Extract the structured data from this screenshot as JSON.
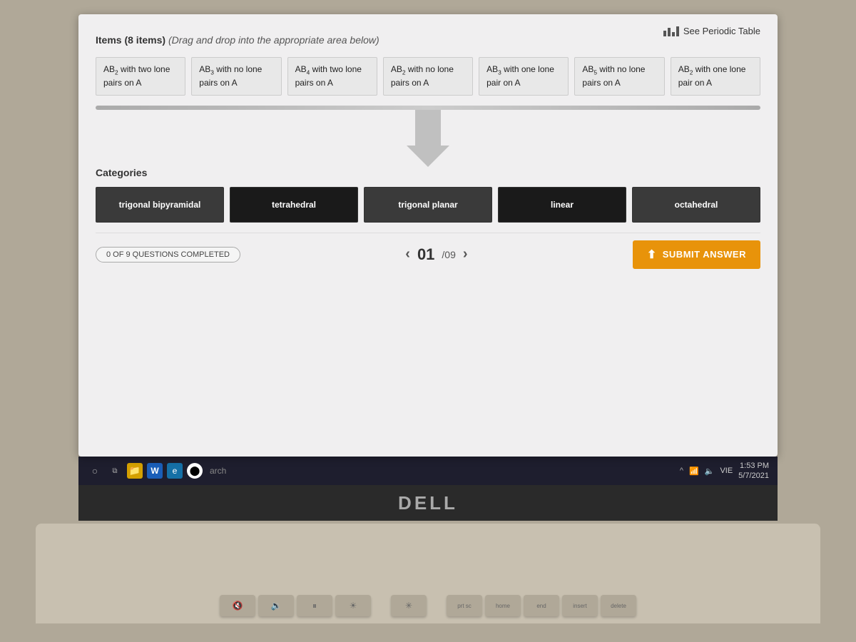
{
  "header": {
    "periodic_table_link": "See Periodic Table",
    "items_label": "Items (8 items)",
    "items_instruction": "(Drag and drop into the appropriate area below)"
  },
  "drag_items": [
    {
      "id": "item1",
      "label": "AB₂ with two lone pairs on A"
    },
    {
      "id": "item2",
      "label": "AB₃ with no lone pairs on A"
    },
    {
      "id": "item3",
      "label": "AB₄ with two lone pairs on A"
    },
    {
      "id": "item4",
      "label": "AB₂ with no lone pairs on A"
    },
    {
      "id": "item5",
      "label": "AB₃ with one lone pair on A"
    },
    {
      "id": "item6",
      "label": "AB₅ with no lone pairs on A"
    },
    {
      "id": "item7",
      "label": "AB₂ with one lone pair on A"
    }
  ],
  "categories_label": "Categories",
  "categories": [
    {
      "id": "cat1",
      "label": "trigonal bipyramidal"
    },
    {
      "id": "cat2",
      "label": "tetrahedral"
    },
    {
      "id": "cat3",
      "label": "trigonal planar"
    },
    {
      "id": "cat4",
      "label": "linear"
    },
    {
      "id": "cat5",
      "label": "octahedral"
    }
  ],
  "progress": {
    "text": "0 OF 9 QUESTIONS COMPLETED",
    "current": "01",
    "total": "/09"
  },
  "submit_button": "SUBMIT ANSWER",
  "taskbar": {
    "search_placeholder": "arch",
    "time": "1:53 PM",
    "date": "5/7/2021",
    "language": "VIE"
  },
  "dell_logo": "DELL"
}
